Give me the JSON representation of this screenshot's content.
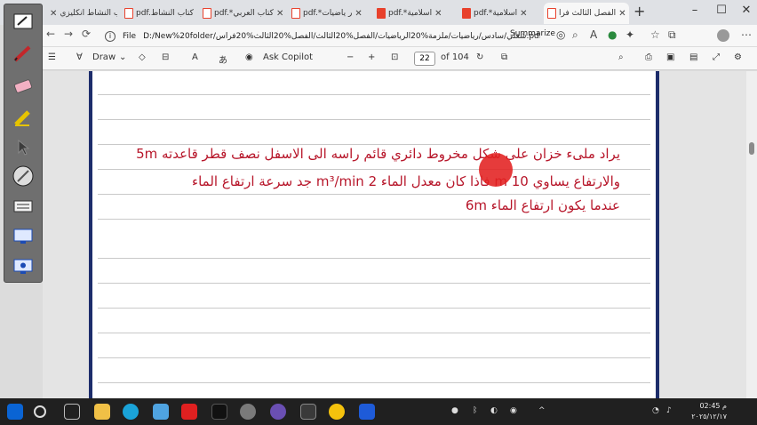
{
  "tabs": [
    {
      "label": "كتاب النشاط انكليزي"
    },
    {
      "label": "pdf.كتاب النشاط"
    },
    {
      "label": "pdf.*كتاب العربي"
    },
    {
      "label": "pdf.*ر ياضيات"
    },
    {
      "label": "pdf.*اسلامية"
    },
    {
      "label": "pdf.*اسلامية"
    },
    {
      "label": "الفصل الثالث فرا"
    }
  ],
  "address": {
    "scheme": "File",
    "path": "D:/New%20folder/شغلي/سادس/رياضيات/ملزمة%20الرياضيات/الفصل%20الثالث/الفصل%20الثالث%20فراس.pdf",
    "summarize": "Summarize"
  },
  "pdf_toolbar": {
    "draw": "Draw",
    "ask_copilot": "Ask Copilot",
    "page": "22",
    "of_pages": "of 104"
  },
  "document": {
    "line1": "يراد ملىء خزان على شكل مخروط دائري قائم راسه الى الاسفل نصف قطر قاعدته 5m",
    "line2": "والارتفاع يساوي 10 m  فاذا كان معدل الماء 2 m³/min جد سرعة ارتفاع الماء",
    "line3": "عندما يكون ارتفاع الماء  6m"
  },
  "taskbar": {
    "time": "02:45 م",
    "date": "٢٠٢٥/١٢/١٧"
  }
}
